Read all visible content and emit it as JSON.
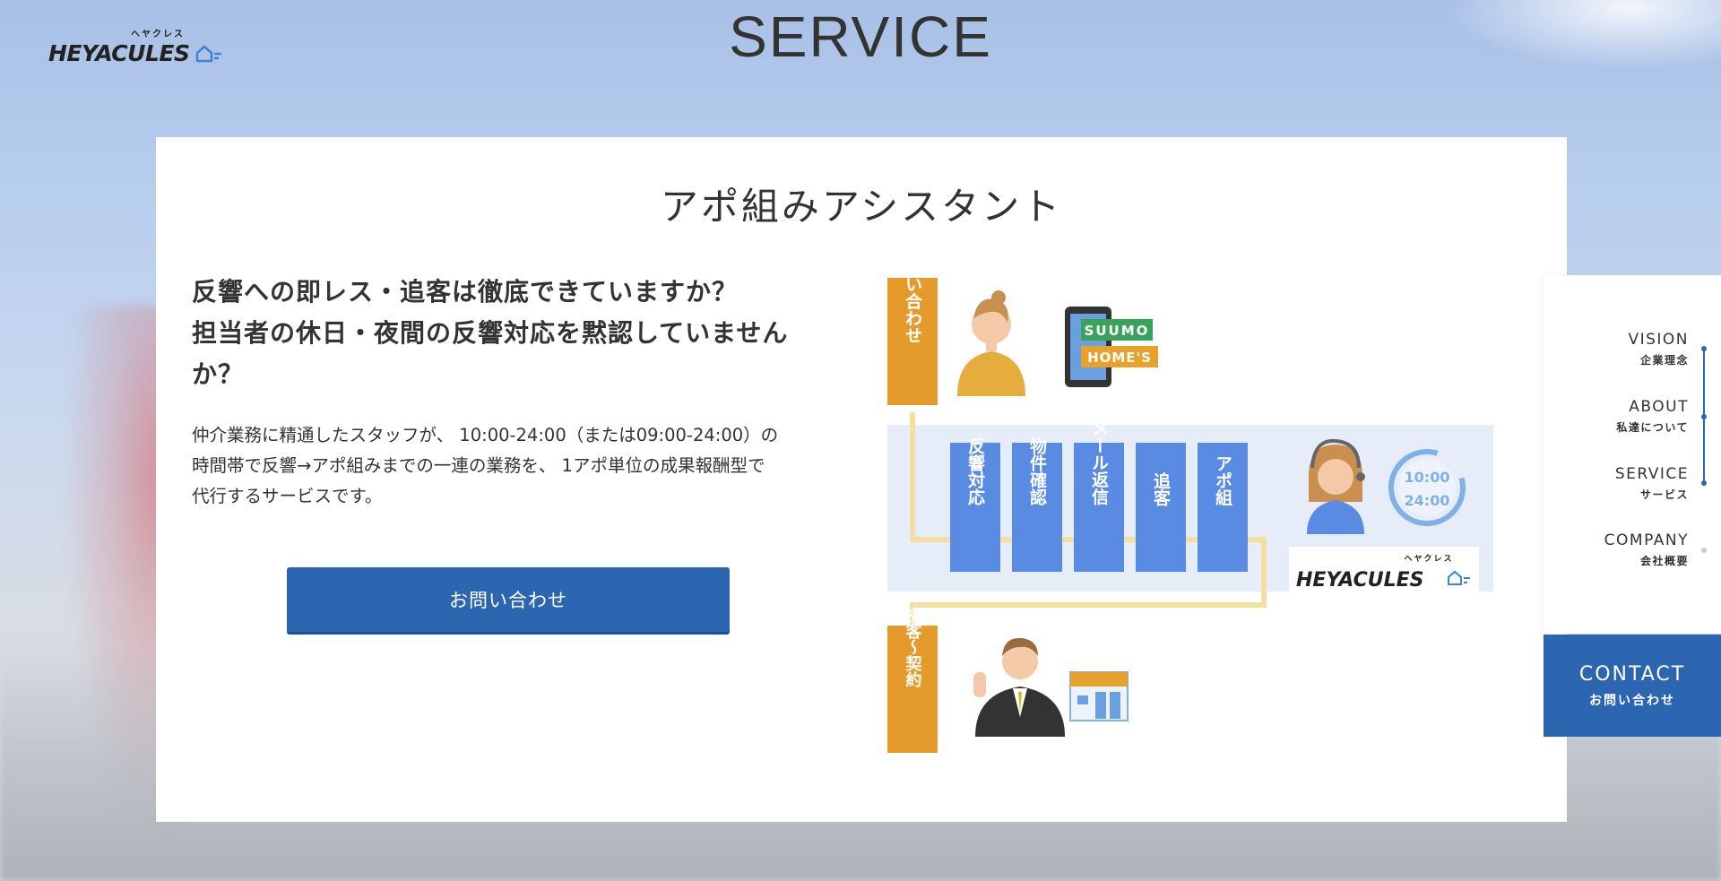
{
  "brand": {
    "logo_text": "HEYACULES",
    "logo_kana": "ヘヤクレス"
  },
  "page": {
    "title": "SERVICE"
  },
  "service": {
    "title": "アポ組みアシスタント",
    "headline_lines": [
      "反響への即レス・追客は徹底できていますか？",
      "担当者の休日・夜間の反響対応を黙認していません",
      "か？"
    ],
    "body_lines": [
      "仲介業務に精通したスタッフが、 10:00-24:00（または09:00-24:00）の",
      "時間帯で反響→アポ組みまでの一連の業務を、 1アポ単位の成果報酬型で",
      "代行するサービスです。"
    ],
    "cta_label": "お問い合わせ"
  },
  "diagram": {
    "inquiry_label": "問い合わせ",
    "portal_1": "SUUMO",
    "portal_2": "HOME'S",
    "steps": [
      "反響対応",
      "物件確認",
      "メール返信",
      "追客",
      "アポ組"
    ],
    "hours_1": "10:00",
    "hours_2": "24:00",
    "brand": "HEYACULES",
    "brand_kana": "ヘヤクレス",
    "contract_label": "接客〜契約"
  },
  "nav": {
    "items": [
      {
        "en": "VISION",
        "ja": "企業理念"
      },
      {
        "en": "ABOUT",
        "ja": "私達について"
      },
      {
        "en": "SERVICE",
        "ja": "サービス"
      },
      {
        "en": "COMPANY",
        "ja": "会社概要"
      }
    ],
    "contact_en": "CONTACT",
    "contact_ja": "お問い合わせ"
  },
  "colors": {
    "primary_blue": "#2c66b0",
    "step_blue": "#5a8be2",
    "orange": "#e59a2c",
    "suumo_green": "#3aa35b",
    "homes_orange": "#e6a22a",
    "flow_yellow": "#f5dfa0",
    "diagram_band": "#e6edf8"
  },
  "icons": [
    "house-icon",
    "clock-icon",
    "smartphone-icon",
    "person-icon",
    "operator-icon",
    "agent-icon",
    "store-icon"
  ]
}
